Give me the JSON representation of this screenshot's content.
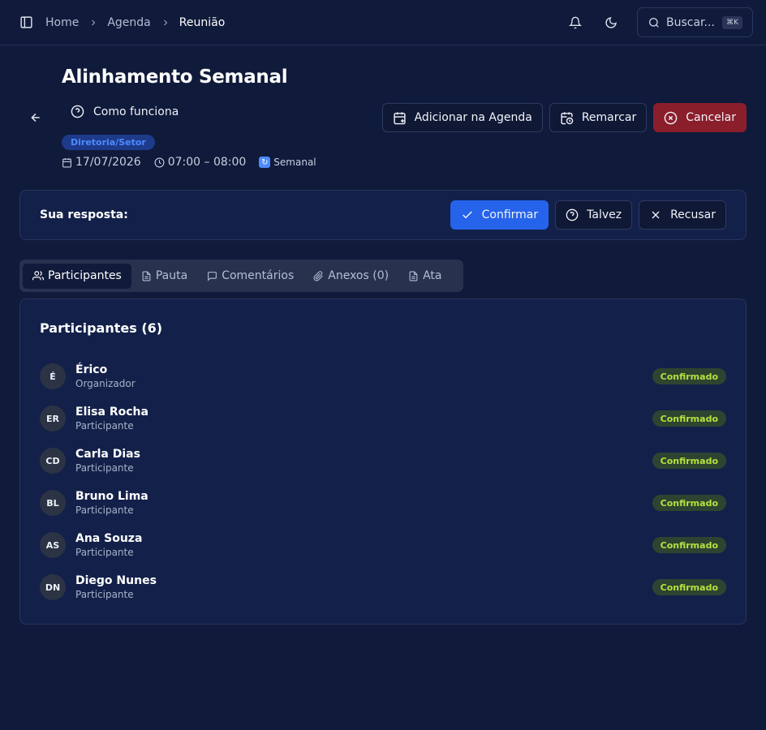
{
  "breadcrumb": [
    "Home",
    "Agenda",
    "Reunião"
  ],
  "search": {
    "label": "Buscar...",
    "shortcut": "⌘K"
  },
  "meeting": {
    "title": "Alinhamento Semanal",
    "how_it_works": "Como funciona",
    "tag": "Diretoria/Setor",
    "date": "17/07/2026",
    "time": "07:00 – 08:00",
    "recurrence": "Semanal"
  },
  "actions": {
    "add_calendar": "Adicionar na Agenda",
    "reschedule": "Remarcar",
    "cancel": "Cancelar"
  },
  "response": {
    "label": "Sua resposta:",
    "confirm": "Confirmar",
    "maybe": "Talvez",
    "decline": "Recusar"
  },
  "tabs": [
    {
      "label": "Participantes",
      "icon": "users-icon"
    },
    {
      "label": "Pauta",
      "icon": "document-icon"
    },
    {
      "label": "Comentários",
      "icon": "comment-icon"
    },
    {
      "label": "Anexos (0)",
      "icon": "paperclip-icon"
    },
    {
      "label": "Ata",
      "icon": "document-icon"
    }
  ],
  "participants": {
    "heading": "Participantes (6)",
    "items": [
      {
        "initials": "É",
        "name": "Érico",
        "role": "Organizador",
        "status": "Confirmado"
      },
      {
        "initials": "ER",
        "name": "Elisa Rocha",
        "role": "Participante",
        "status": "Confirmado"
      },
      {
        "initials": "CD",
        "name": "Carla Dias",
        "role": "Participante",
        "status": "Confirmado"
      },
      {
        "initials": "BL",
        "name": "Bruno Lima",
        "role": "Participante",
        "status": "Confirmado"
      },
      {
        "initials": "AS",
        "name": "Ana Souza",
        "role": "Participante",
        "status": "Confirmado"
      },
      {
        "initials": "DN",
        "name": "Diego Nunes",
        "role": "Participante",
        "status": "Confirmado"
      }
    ]
  },
  "colors": {
    "background": "#101a3a",
    "primary": "#2563eb",
    "danger": "#8b1e2b",
    "confirmed": "#b5e23f"
  }
}
